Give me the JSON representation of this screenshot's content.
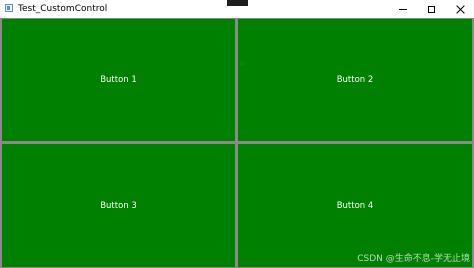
{
  "window": {
    "title": "Test_CustomControl",
    "controls": {
      "minimize": "minimize-icon",
      "maximize": "maximize-icon",
      "close": "close-icon"
    }
  },
  "buttons": [
    {
      "label": "Button 1"
    },
    {
      "label": "Button 2"
    },
    {
      "label": "Button 3"
    },
    {
      "label": "Button 4"
    }
  ],
  "colors": {
    "button_background": "#008000",
    "button_text": "#ffffff",
    "divider": "#8a8a8a"
  },
  "watermark": "CSDN @生命不息-学无止境"
}
